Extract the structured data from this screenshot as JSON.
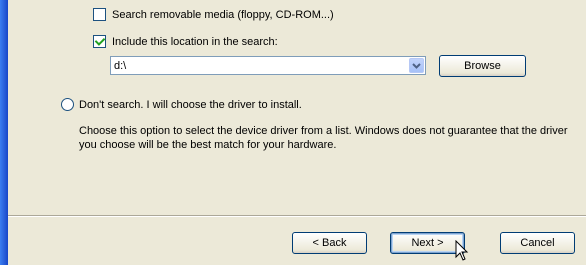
{
  "options": {
    "search_removable_label": "Search removable media (floppy, CD-ROM...)",
    "search_removable_checked": false,
    "include_location_label": "Include this location in the search:",
    "include_location_checked": true,
    "location_value": "d:\\",
    "browse_label": "Browse",
    "dont_search_label": "Don't search. I will choose the driver to install.",
    "dont_search_description": "Choose this option to select the device driver from a list.  Windows does not guarantee that the driver you choose will be the best match for your hardware."
  },
  "footer": {
    "back_label": "< Back",
    "next_label": "Next >",
    "cancel_label": "Cancel"
  },
  "colors": {
    "dialog_background": "#ece9d8",
    "sidebar_blue": "#1c5cd6",
    "check_green": "#21a121"
  },
  "icons": {
    "combo_arrow": "chevron-down-icon",
    "cursor": "mouse-pointer-icon"
  }
}
